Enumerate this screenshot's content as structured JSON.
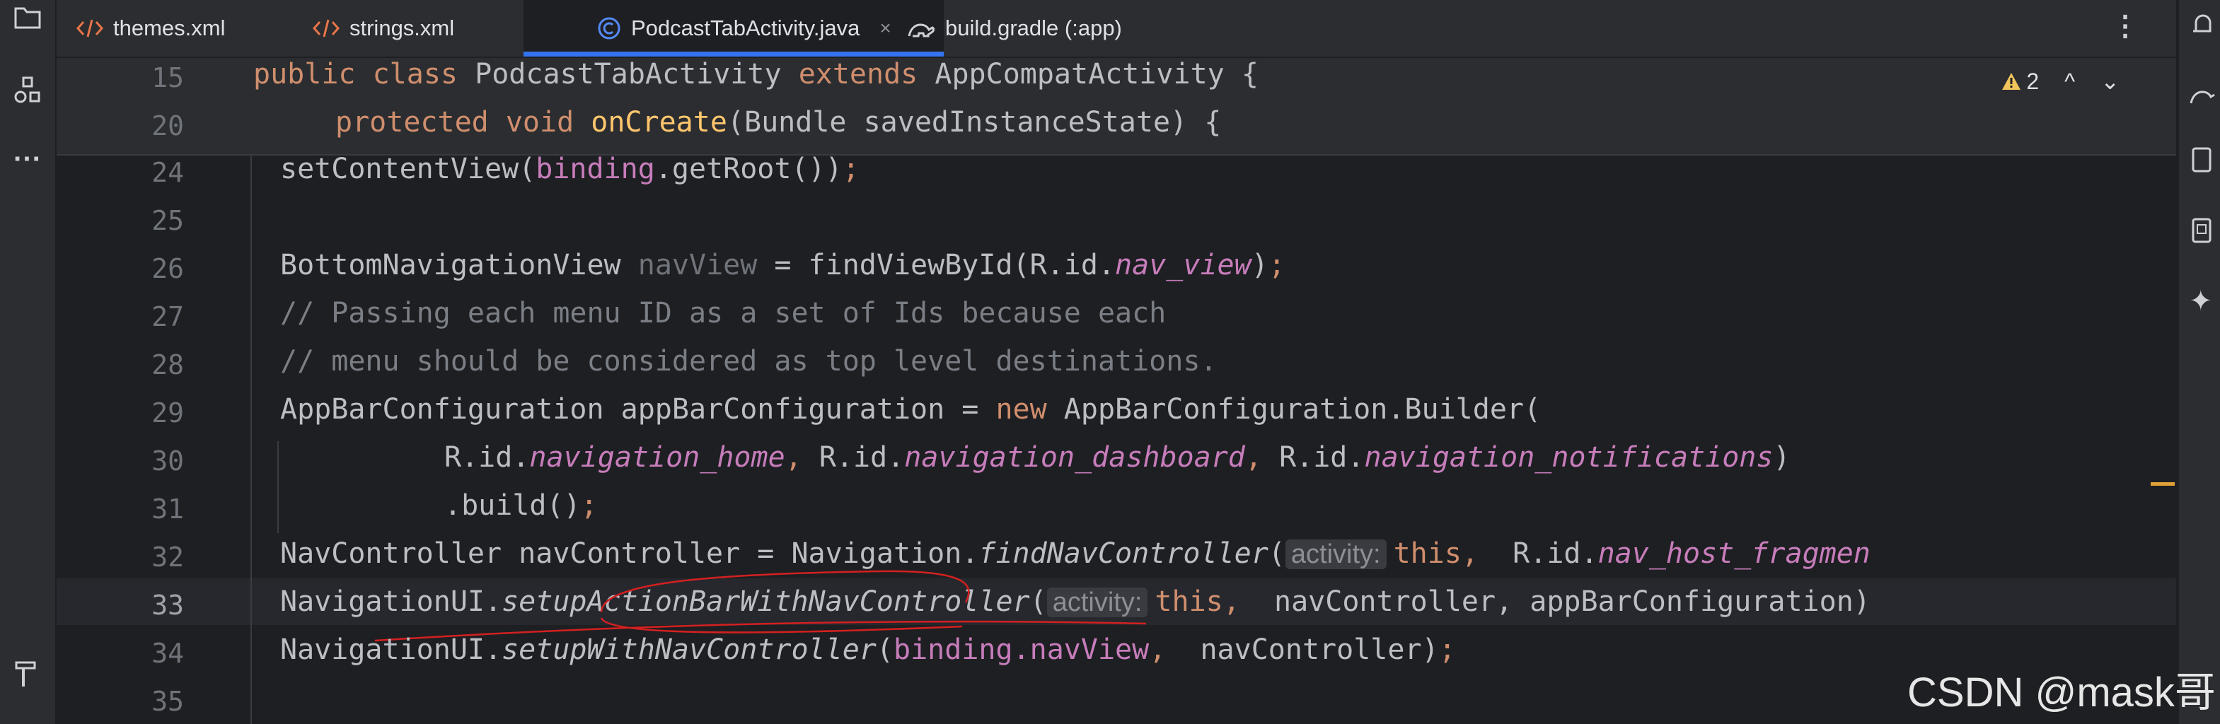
{
  "tabs": [
    {
      "label": "themes.xml",
      "icon": "xml-icon",
      "active": false
    },
    {
      "label": "strings.xml",
      "icon": "xml-icon",
      "active": false
    },
    {
      "label": "PodcastTabActivity.java",
      "icon": "java-class-icon",
      "active": true,
      "close": "×"
    },
    {
      "label": "build.gradle (:app)",
      "icon": "gradle-icon",
      "active": false
    }
  ],
  "more_menu": "⋮",
  "warnings": {
    "count": "2",
    "up": "^",
    "down": "⌄"
  },
  "sticky": {
    "line15": {
      "num": "15",
      "kw1": "public",
      "kw2": "class",
      "cls": "PodcastTabActivity",
      "kw3": "extends",
      "sup": "AppCompatActivity {"
    },
    "line20": {
      "num": "20",
      "kw1": "protected",
      "kw2": "void",
      "method": "onCreate",
      "rest": "(Bundle savedInstanceState) {"
    }
  },
  "lines": {
    "l24": {
      "num": "24"
    },
    "l25": {
      "num": "25"
    },
    "l26": {
      "num": "26"
    },
    "l27": {
      "num": "27",
      "text": "// Passing each menu ID as a set of Ids because each"
    },
    "l28": {
      "num": "28",
      "text": "// menu should be considered as top level destinations."
    },
    "l29": {
      "num": "29"
    },
    "l30": {
      "num": "30"
    },
    "l31": {
      "num": "31"
    },
    "l32": {
      "num": "32"
    },
    "l33": {
      "num": "33"
    },
    "l34": {
      "num": "34"
    },
    "l35": {
      "num": "35"
    }
  },
  "code": {
    "setContentView": "setContentView(",
    "binding": "binding",
    "getRoot": ".getRoot())",
    "semi": ";",
    "bnv": "BottomNavigationView ",
    "navView": "navView",
    "findById": " = findViewById(R.id.",
    "nav_view": "nav_view",
    "close_paren": ")",
    "abc_type": "AppBarConfiguration appBarConfiguration = ",
    "new": "new",
    "abc_builder": " AppBarConfiguration.Builder(",
    "rid": "R.id.",
    "navigation_home": "navigation_home",
    "comma": ", ",
    "navigation_dashboard": "navigation_dashboard",
    "navigation_notifications": "navigation_notifications",
    "build": ".build()",
    "navctrl": "NavController navController = Navigation.",
    "findNavController": "findNavController",
    "open_paren": "(",
    "hint_activity": "activity:",
    "this": "this",
    "rid2": " R.id.",
    "nav_host": "nav_host_fragmen",
    "navui": "NavigationUI.",
    "setupAB": "setupActionBarWithNavController",
    "tail33": " navController, appBarConfiguration)",
    "setupWith": "setupWithNavController",
    "tail34": " navController)",
    "navView2": ".navView"
  },
  "watermark": "CSDN @mask哥"
}
